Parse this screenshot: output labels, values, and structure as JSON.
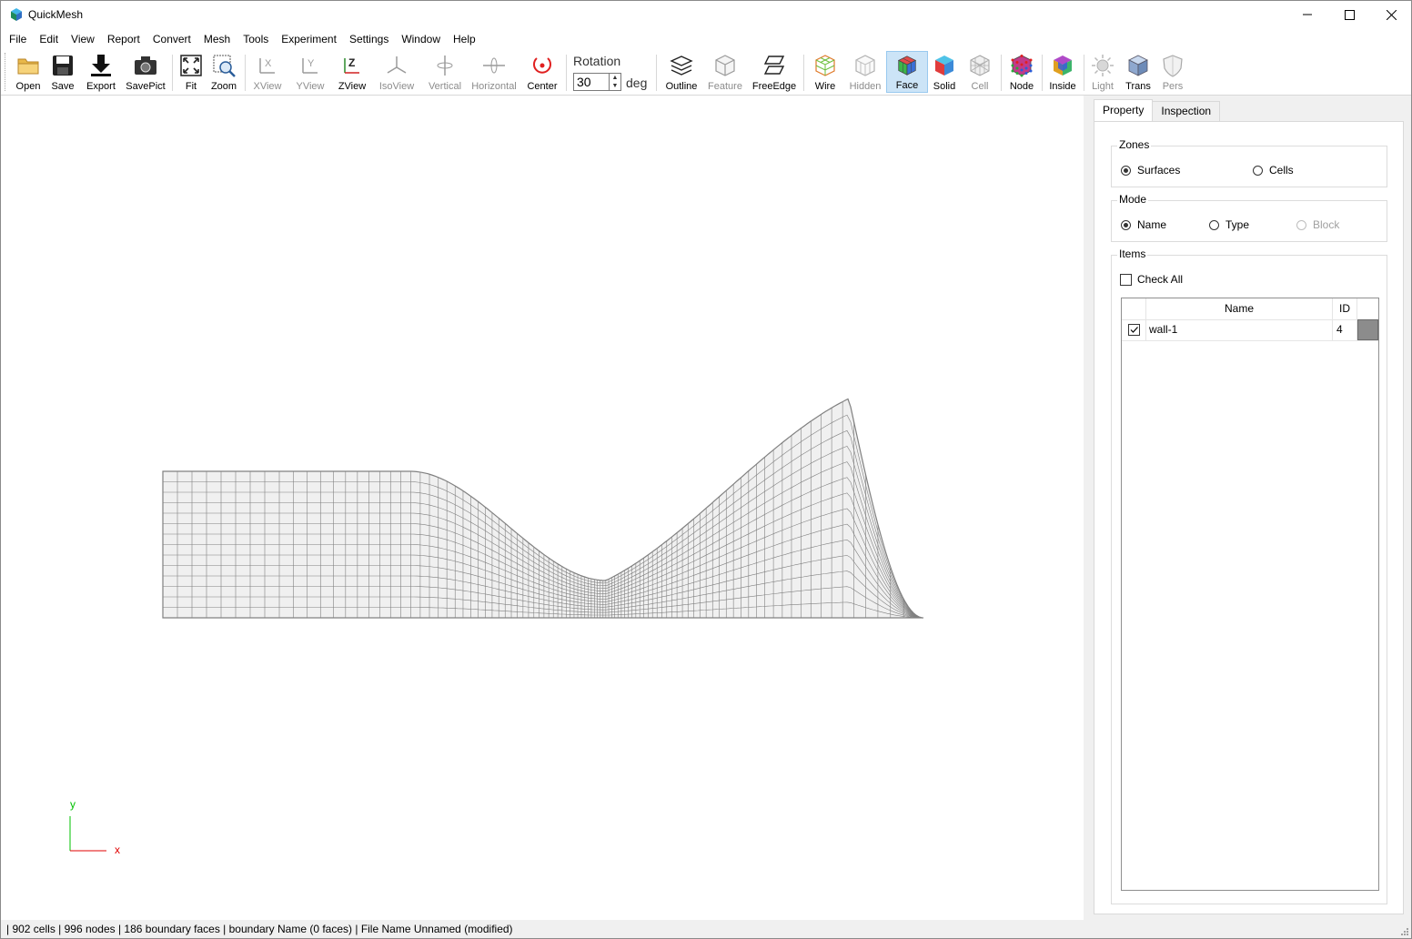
{
  "window": {
    "title": "QuickMesh",
    "minimize_icon": "minimize-icon",
    "maximize_icon": "maximize-icon",
    "close_icon": "close-icon"
  },
  "menu": [
    "File",
    "Edit",
    "View",
    "Report",
    "Convert",
    "Mesh",
    "Tools",
    "Experiment",
    "Settings",
    "Window",
    "Help"
  ],
  "toolbar": {
    "open": "Open",
    "save": "Save",
    "export": "Export",
    "savepict": "SavePict",
    "fit": "Fit",
    "zoom": "Zoom",
    "xview": "XView",
    "yview": "YView",
    "zview": "ZView",
    "isoview": "IsoView",
    "vertical": "Vertical",
    "horizontal": "Horizontal",
    "center": "Center",
    "rotation_label": "Rotation",
    "rotation_value": "30",
    "rotation_unit": "deg",
    "outline": "Outline",
    "feature": "Feature",
    "freeedge": "FreeEdge",
    "wire": "Wire",
    "hidden": "Hidden",
    "face": "Face",
    "solid": "Solid",
    "cell": "Cell",
    "node": "Node",
    "inside": "Inside",
    "light": "Light",
    "trans": "Trans",
    "pers": "Pers"
  },
  "viewport": {
    "axis_y": "y",
    "axis_x": "x",
    "colors": {
      "mesh_fill": "#f0f0f0",
      "mesh_line": "#808080",
      "axis_y": "#00c000",
      "axis_x": "#e00000"
    }
  },
  "panel": {
    "tabs": [
      "Property",
      "Inspection"
    ],
    "zones": {
      "title": "Zones",
      "options": [
        "Surfaces",
        "Cells"
      ],
      "selected": "Surfaces"
    },
    "mode": {
      "title": "Mode",
      "options": [
        "Name",
        "Type",
        "Block"
      ],
      "selected": "Name"
    },
    "items": {
      "title": "Items",
      "check_all": "Check All",
      "columns": [
        "Name",
        "ID"
      ],
      "rows": [
        {
          "checked": true,
          "name": "wall-1",
          "id": "4",
          "color": "#8c8c8c"
        }
      ]
    }
  },
  "status": {
    "text": "| 902 cells | 996 nodes | 186 boundary faces |  boundary Name  (0 faces) | File Name Unnamed (modified)"
  }
}
